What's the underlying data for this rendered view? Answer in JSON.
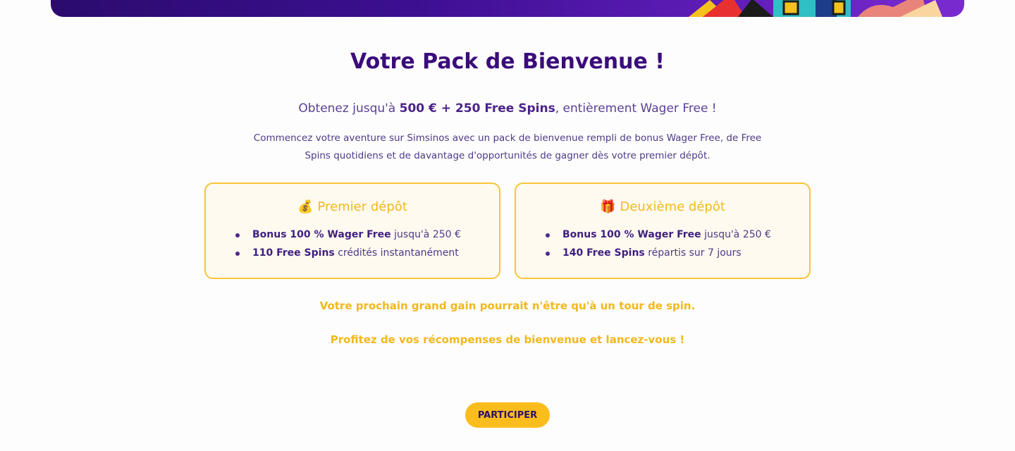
{
  "welcome": {
    "title": "Votre Pack de Bienvenue !",
    "subtitle": {
      "prefix": "Obtenez jusqu'à ",
      "bold": "500 € + 250 Free Spins",
      "suffix": ", entièrement Wager Free !"
    },
    "description": "Commencez votre aventure sur Simsinos avec un pack de bienvenue rempli de bonus Wager Free, de Free Spins quotidiens et de davantage d'opportunités de gagner dès votre premier dépôt."
  },
  "cards": [
    {
      "icon": "money-bag-icon",
      "emoji": "💰",
      "title": "Premier dépôt",
      "items": [
        {
          "bold": "Bonus 100 % Wager Free",
          "text": " jusqu'à 250 €"
        },
        {
          "bold": "110 Free Spins",
          "text": " crédités instantanément"
        }
      ]
    },
    {
      "icon": "gift-icon",
      "emoji": "🎁",
      "title": "Deuxième dépôt",
      "items": [
        {
          "bold": "Bonus 100 % Wager Free",
          "text": " jusqu'à 250 €"
        },
        {
          "bold": "140 Free Spins",
          "text": " répartis sur 7 jours"
        }
      ]
    }
  ],
  "taglines": [
    "Votre prochain grand gain pourrait n'être qu'à un tour de spin.",
    "Profitez de vos récompenses de bienvenue et lancez-vous !"
  ],
  "cta": {
    "label": "PARTICIPER"
  },
  "colors": {
    "primary": "#3a0c7a",
    "accent": "#f2b81c",
    "card_bg": "#fffaf0",
    "button": "#fbbd1c"
  }
}
